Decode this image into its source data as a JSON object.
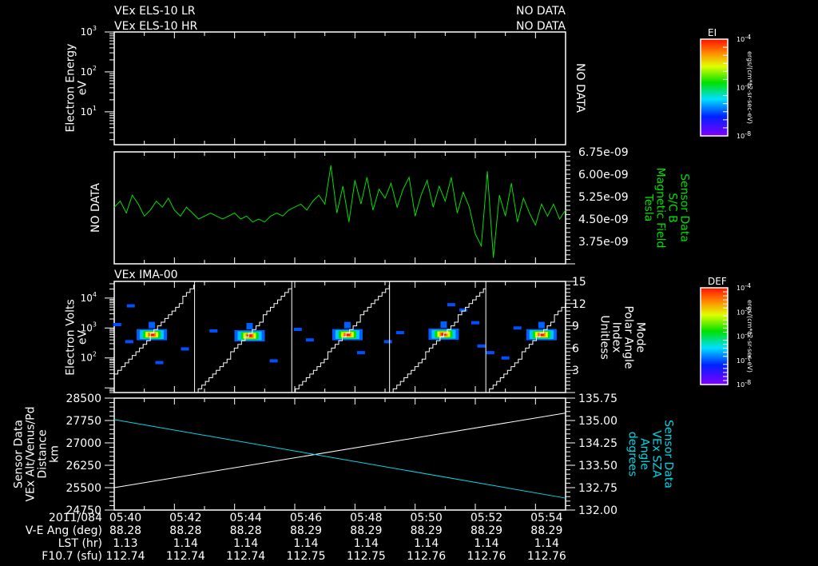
{
  "header": {
    "title1": "VEx ELS-10 LR",
    "title2": "VEx ELS-10 HR",
    "nodata1": "NO DATA",
    "nodata2": "NO DATA",
    "ima_title": "VEx IMA-00"
  },
  "colors": {
    "bfield": "#00e000",
    "sza": "#00d8e8",
    "axis": "#ffffff",
    "background": "#000000"
  },
  "chart_data": [
    {
      "type": "heatmap",
      "name": "electron-energy",
      "ylabel": [
        "Electron Energy",
        "eV"
      ],
      "yticks": [
        "10^1",
        "10^2",
        "10^3"
      ],
      "ylim": [
        1,
        1000
      ],
      "no_data_label": "NO DATA",
      "colorbar": {
        "title": "EI",
        "ticks": [
          "10^-4",
          "10^-6",
          "10^-8"
        ],
        "units": "ergs/(cm**2-sr-sec-eV)"
      }
    },
    {
      "type": "line",
      "name": "magnetic-field",
      "left_label": "NO DATA",
      "ylabel": [
        "Sensor Data",
        "S/C B",
        "Magnetic Field",
        "Tesla"
      ],
      "yticks": [
        "3.75e-09",
        "4.50e-09",
        "5.25e-09",
        "6.00e-09",
        "6.75e-09"
      ],
      "ylim": [
        3e-09,
        6.75e-09
      ],
      "x_start_min": 0,
      "x_step_min": 0.2,
      "values_nT": [
        4.9,
        5.1,
        4.7,
        5.3,
        5.0,
        4.6,
        4.8,
        5.1,
        4.9,
        5.2,
        4.8,
        4.6,
        4.9,
        4.7,
        4.5,
        4.6,
        4.7,
        4.6,
        4.5,
        4.6,
        4.7,
        4.5,
        4.6,
        4.4,
        4.5,
        4.4,
        4.6,
        4.7,
        4.6,
        4.8,
        4.9,
        5.0,
        4.8,
        5.1,
        5.3,
        5.0,
        6.3,
        4.7,
        5.6,
        4.4,
        5.8,
        5.0,
        5.9,
        4.8,
        5.5,
        5.2,
        5.7,
        4.9,
        5.5,
        5.9,
        4.6,
        5.3,
        5.8,
        4.9,
        5.6,
        5.1,
        5.9,
        4.7,
        5.4,
        4.9,
        4.0,
        3.6,
        6.1,
        3.2,
        5.3,
        4.6,
        5.7,
        4.4,
        5.2,
        4.7,
        4.3,
        5.0,
        4.6,
        5.0,
        4.5,
        4.8
      ]
    },
    {
      "type": "heatmap",
      "name": "ion-spectrogram",
      "ylabel": [
        "Electron Volts",
        "eV"
      ],
      "yticks": [
        "10^2",
        "10^3",
        "10^4"
      ],
      "ylim": [
        7,
        36000
      ],
      "right_ylabel": [
        "Mode",
        "Polar Angle",
        "Index",
        "Unitless"
      ],
      "right_yticks": [
        "3",
        "6",
        "9",
        "12",
        "15"
      ],
      "right_ylim": [
        0,
        15
      ],
      "mode_start_value": 2.5,
      "mode_resets_min": [
        2.67,
        5.9,
        9.15,
        12.35
      ],
      "peaks": [
        {
          "t": 1.25,
          "eV": 600
        },
        {
          "t": 4.5,
          "eV": 550
        },
        {
          "t": 7.75,
          "eV": 600
        },
        {
          "t": 10.95,
          "eV": 620
        },
        {
          "t": 14.2,
          "eV": 600
        }
      ],
      "scatter": [
        {
          "t": 0.55,
          "eV": 5500
        },
        {
          "t": 0.1,
          "eV": 1300
        },
        {
          "t": 0.5,
          "eV": 350
        },
        {
          "t": 2.35,
          "eV": 200
        },
        {
          "t": 1.5,
          "eV": 70
        },
        {
          "t": 3.3,
          "eV": 800
        },
        {
          "t": 5.3,
          "eV": 80
        },
        {
          "t": 6.1,
          "eV": 900
        },
        {
          "t": 6.5,
          "eV": 400
        },
        {
          "t": 8.2,
          "eV": 150
        },
        {
          "t": 9.1,
          "eV": 350
        },
        {
          "t": 9.5,
          "eV": 700
        },
        {
          "t": 11.2,
          "eV": 6000
        },
        {
          "t": 11.6,
          "eV": 4000
        },
        {
          "t": 12.0,
          "eV": 1500
        },
        {
          "t": 12.2,
          "eV": 250
        },
        {
          "t": 12.5,
          "eV": 150
        },
        {
          "t": 13.0,
          "eV": 100
        },
        {
          "t": 13.4,
          "eV": 1000
        }
      ],
      "colorbar": {
        "title": "DEF",
        "ticks": [
          "10^-4",
          "10^-5",
          "10^-6",
          "10^-7",
          "10^-8"
        ],
        "units": "ergs/(cm**2-sr-sec-eV)"
      }
    },
    {
      "type": "line",
      "name": "altitude-sza",
      "ylabel": [
        "Sensor Data",
        "VEx Alt/Venus/Pd",
        "Distance",
        "km"
      ],
      "yticks": [
        "24750",
        "25500",
        "26250",
        "27000",
        "27750",
        "28500"
      ],
      "ylim": [
        24750,
        28500
      ],
      "altitude_km": {
        "start": 25500,
        "end": 28000
      },
      "right_ylabel": [
        "Sensor Data",
        "VEx SZA",
        "Angle",
        "degrees"
      ],
      "right_yticks": [
        "132.00",
        "132.75",
        "133.50",
        "134.25",
        "135.00",
        "135.75"
      ],
      "right_ylim": [
        132.0,
        135.75
      ],
      "sza_deg": {
        "start": 135.03,
        "end": 132.4
      }
    }
  ],
  "xaxis": {
    "start_min": 0,
    "end_min": 15,
    "row_labels": [
      "2011/084",
      "V-E Ang (deg)",
      "LST (hr)",
      "F10.7 (sfu)"
    ],
    "times": [
      "05:40",
      "05:42",
      "05:44",
      "05:46",
      "05:48",
      "05:50",
      "05:52",
      "05:54"
    ],
    "ve_ang": [
      "88.28",
      "88.28",
      "88.28",
      "88.29",
      "88.29",
      "88.29",
      "88.29",
      "88.29"
    ],
    "lst": [
      "1.13",
      "1.14",
      "1.14",
      "1.14",
      "1.14",
      "1.14",
      "1.14",
      "1.14"
    ],
    "f107": [
      "112.74",
      "112.74",
      "112.74",
      "112.75",
      "112.75",
      "112.76",
      "112.76",
      "112.76"
    ]
  }
}
